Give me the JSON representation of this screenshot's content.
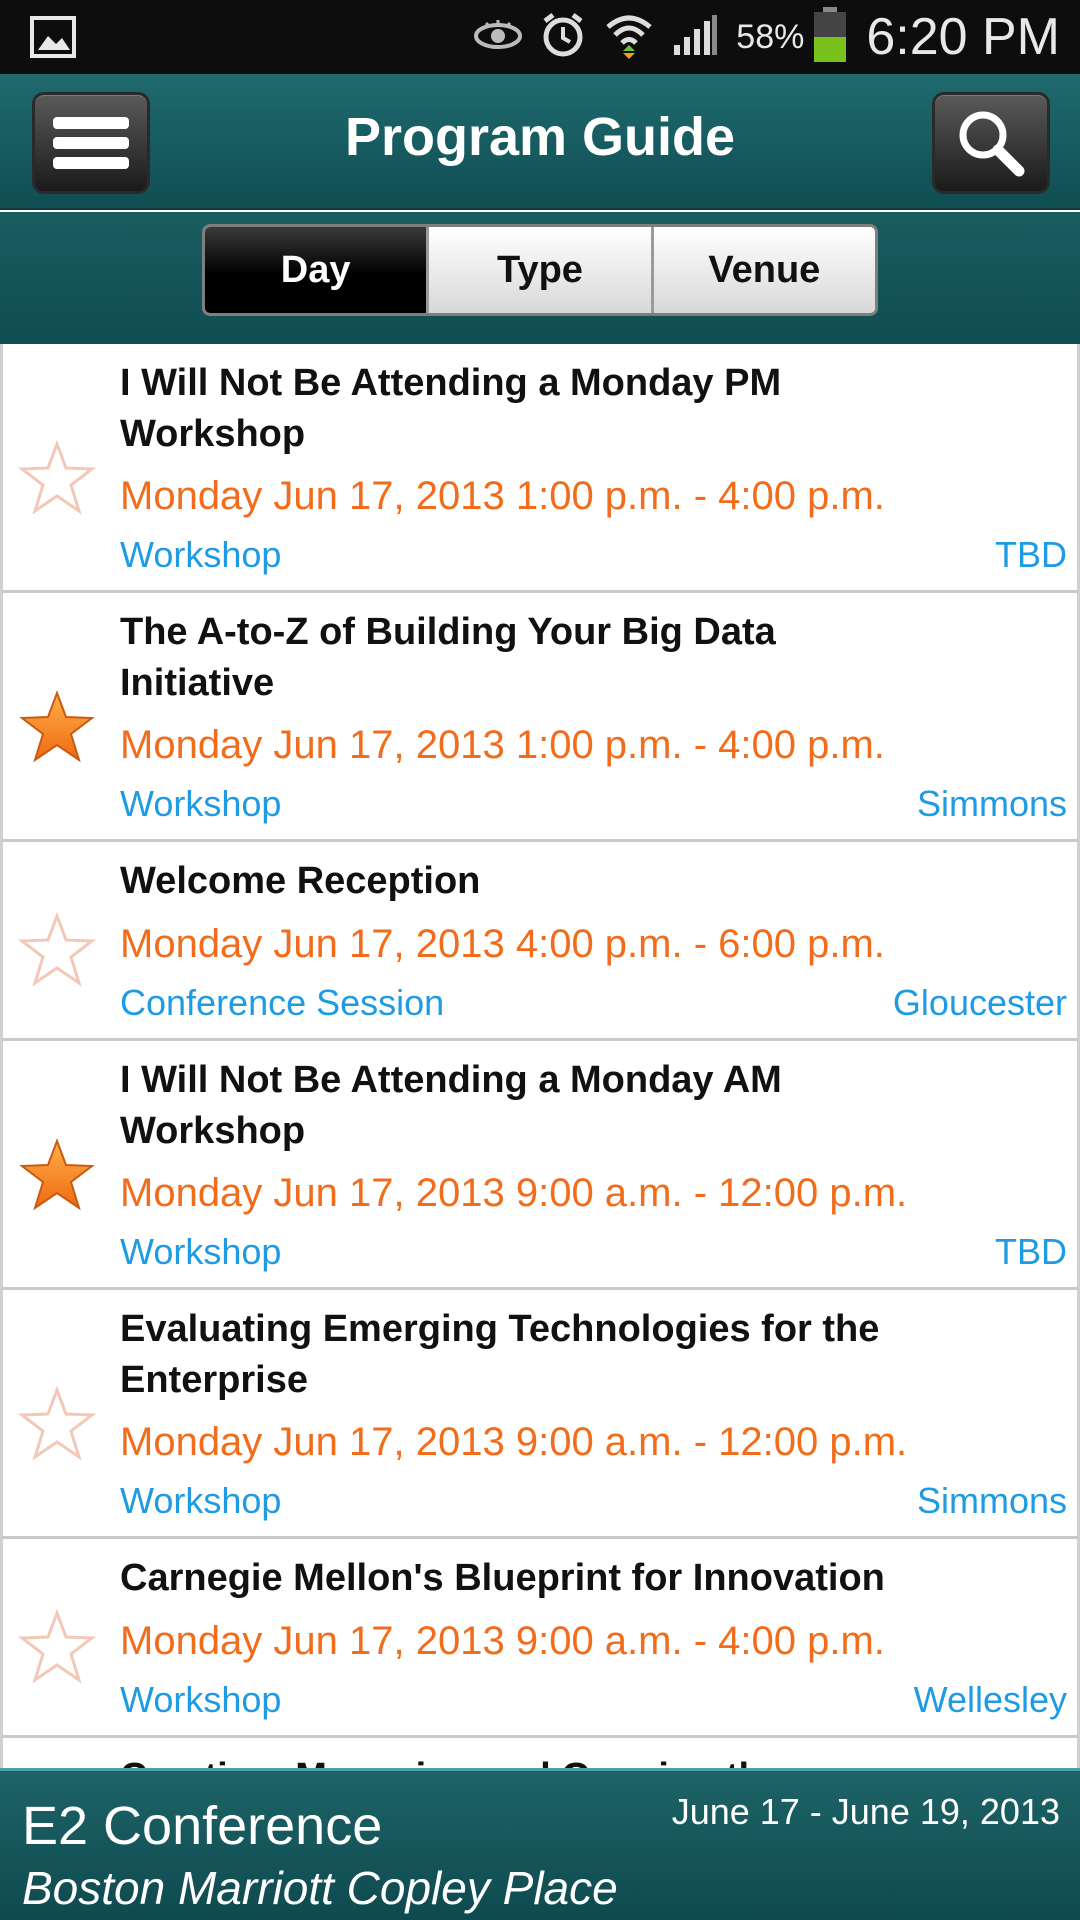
{
  "status_bar": {
    "battery_percent": "58%",
    "time": "6:20 PM",
    "icons": [
      "image-notification-icon",
      "eye-icon",
      "alarm-icon",
      "wifi-icon",
      "signal-icon",
      "battery-icon"
    ]
  },
  "header": {
    "title": "Program Guide",
    "menu_icon": "hamburger-menu-icon",
    "search_icon": "search-icon"
  },
  "tabs": [
    {
      "label": "Day",
      "active": true
    },
    {
      "label": "Type",
      "active": false
    },
    {
      "label": "Venue",
      "active": false
    }
  ],
  "sessions": [
    {
      "title_lines": [
        "I Will Not Be Attending a Monday PM",
        "Workshop"
      ],
      "time": "Monday Jun 17, 2013 1:00 p.m. - 4:00 p.m.",
      "type": "Workshop",
      "venue": "TBD",
      "starred": false
    },
    {
      "title_lines": [
        "The A-to-Z of Building Your Big Data",
        "Initiative"
      ],
      "time": "Monday Jun 17, 2013 1:00 p.m. - 4:00 p.m.",
      "type": "Workshop",
      "venue": "Simmons",
      "starred": true
    },
    {
      "title_lines": [
        "Welcome Reception"
      ],
      "time": "Monday Jun 17, 2013 4:00 p.m. - 6:00 p.m.",
      "type": "Conference Session",
      "venue": "Gloucester",
      "starred": false
    },
    {
      "title_lines": [
        "I Will Not Be Attending a Monday AM",
        "Workshop"
      ],
      "time": "Monday Jun 17, 2013 9:00 a.m. - 12:00 p.m.",
      "type": "Workshop",
      "venue": "TBD",
      "starred": true
    },
    {
      "title_lines": [
        "Evaluating Emerging Technologies for the",
        "Enterprise"
      ],
      "time": "Monday Jun 17, 2013 9:00 a.m. - 12:00 p.m.",
      "type": "Workshop",
      "venue": "Simmons",
      "starred": false
    },
    {
      "title_lines": [
        "Carnegie Mellon's Blueprint for Innovation"
      ],
      "time": "Monday Jun 17, 2013 9:00 a.m. - 4:00 p.m.",
      "type": "Workshop",
      "venue": "Wellesley",
      "starred": false
    }
  ],
  "partial_item_title": "Creating, Managing and Growing the",
  "footer": {
    "conference_name": "E2 Conference",
    "dates": "June 17 - June 19, 2013",
    "place": "Boston Marriott Copley Place"
  },
  "colors": {
    "header_teal": "#1f6a6e",
    "time_orange": "#f26d1b",
    "meta_blue": "#1e9be3",
    "star_filled": "#f5821f"
  }
}
